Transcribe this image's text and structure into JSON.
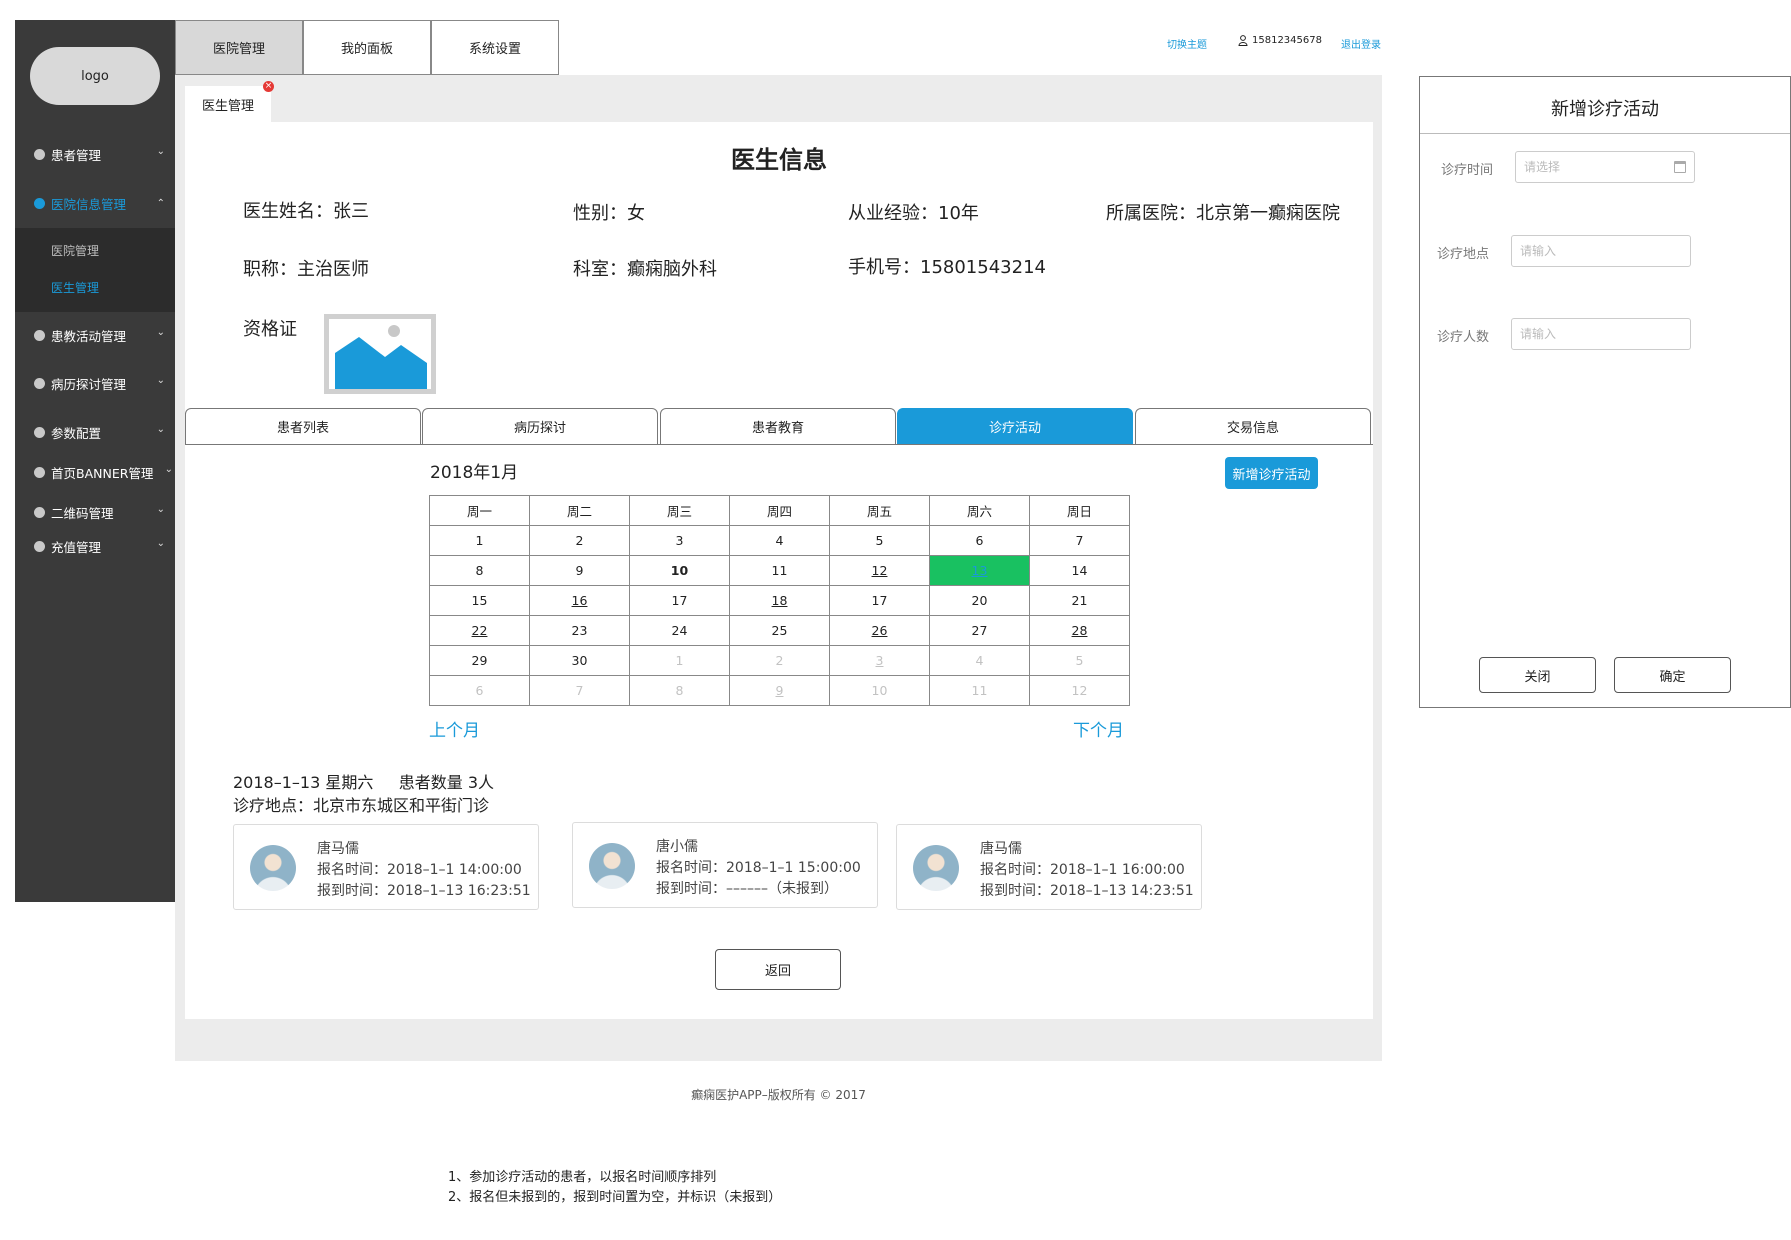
{
  "sidebar": {
    "logo": "logo",
    "items": [
      {
        "label": "患者管理"
      },
      {
        "label": "医院信息管理"
      },
      {
        "label": "患教活动管理"
      },
      {
        "label": "病历探讨管理"
      },
      {
        "label": "参数配置"
      },
      {
        "label": "首页BANNER管理"
      },
      {
        "label": "二维码管理"
      },
      {
        "label": "充值管理"
      }
    ],
    "subitems": [
      {
        "label": "医院管理"
      },
      {
        "label": "医生管理"
      }
    ]
  },
  "top_tabs": [
    {
      "label": "医院管理"
    },
    {
      "label": "我的面板"
    },
    {
      "label": "系统设置"
    }
  ],
  "header": {
    "switch_theme": "切换主题",
    "user_phone": "15812345678",
    "logout": "退出登录"
  },
  "page_tab": {
    "label": "医生管理"
  },
  "doctor": {
    "title": "医生信息",
    "name": "医生姓名：张三",
    "gender": "性别：女",
    "experience": "从业经验：10年",
    "hospital": "所属医院：北京第一癫痫医院",
    "position": "职称：主治医师",
    "department": "科室：癫痫脑外科",
    "phone": "手机号：15801543214",
    "cert_label": "资格证"
  },
  "detail_tabs": [
    {
      "label": "患者列表"
    },
    {
      "label": "病历探讨"
    },
    {
      "label": "患者教育"
    },
    {
      "label": "诊疗活动"
    },
    {
      "label": "交易信息"
    }
  ],
  "calendar": {
    "month_title": "2018年1月",
    "add_button": "新增诊疗活动",
    "weekdays": [
      "周一",
      "周二",
      "周三",
      "周四",
      "周五",
      "周六",
      "周日"
    ],
    "rows": [
      [
        "1",
        "2",
        "3",
        "4",
        "5",
        "6",
        "7"
      ],
      [
        "8",
        "9",
        "10",
        "11",
        "12",
        "13",
        "14"
      ],
      [
        "15",
        "16",
        "17",
        "18",
        "17",
        "20",
        "21"
      ],
      [
        "22",
        "23",
        "24",
        "25",
        "26",
        "27",
        "28"
      ],
      [
        "29",
        "30",
        "1",
        "2",
        "3",
        "4",
        "5"
      ],
      [
        "6",
        "7",
        "8",
        "9",
        "10",
        "11",
        "12"
      ]
    ],
    "prev": "上个月",
    "next": "下个月"
  },
  "activity": {
    "day_info": "2018–1–13 星期六     患者数量 3人",
    "location": "诊疗地点：北京市东城区和平街门诊",
    "patients": [
      {
        "name": "唐马儒",
        "reg": "报名时间：2018–1–1 14:00:00",
        "arrive": "报到时间：2018–1–13 16:23:51"
      },
      {
        "name": "唐小儒",
        "reg": "报名时间：2018–1–1 15:00:00",
        "arrive": "报到时间：––––––（未报到）"
      },
      {
        "name": "唐马儒",
        "reg": "报名时间：2018–1–1 16:00:00",
        "arrive": "报到时间：2018–1–13 14:23:51"
      }
    ]
  },
  "back_button": "返回",
  "footer": "癫痫医护APP–版权所有 © 2017",
  "notes": [
    "1、参加诊疗活动的患者，以报名时间顺序排列",
    "2、报名但未报到的，报到时间置为空，并标识（未报到）"
  ],
  "modal": {
    "title": "新增诊疗活动",
    "time_label": "诊疗时间",
    "time_placeholder": "请选择",
    "place_label": "诊疗地点",
    "place_placeholder": "请输入",
    "count_label": "诊疗人数",
    "count_placeholder": "请输入",
    "close": "关闭",
    "confirm": "确定"
  },
  "colors": {
    "accent": "#1a9ad9",
    "selected_day": "#19c161",
    "sidebar": "#3a3a3a"
  }
}
